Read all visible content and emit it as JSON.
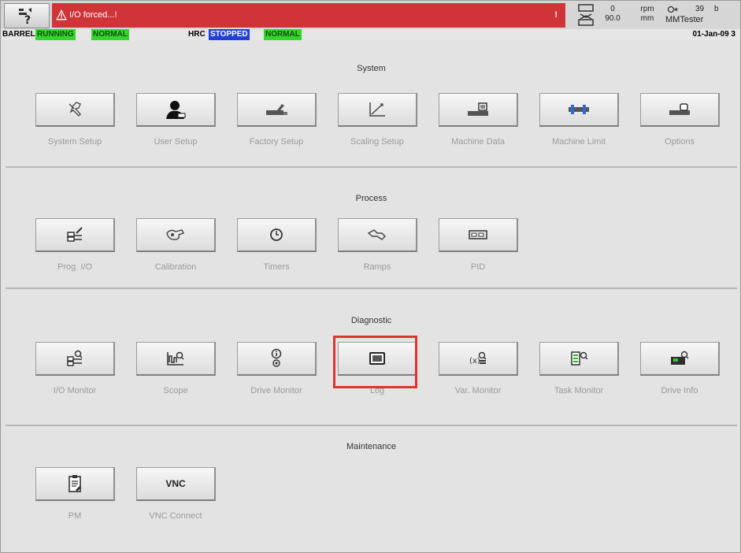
{
  "topbar": {
    "alarm_text": "I/O forced...!",
    "alarm_count": "!",
    "speed_value": "0",
    "speed_value2": "90.0",
    "speed_unit": "rpm",
    "pos_unit": "mm",
    "counter": "39",
    "counter_suffix": "b",
    "user": "MMTester",
    "alarm_color": "#d03438"
  },
  "status": {
    "barrel_label": "BARREL",
    "barrel_state": "RUNNING",
    "barrel_mode": "NORMAL",
    "hrc_label": "HRC",
    "hrc_state": "STOPPED",
    "hrc_mode": "NORMAL",
    "date": "01-Jan-09 3"
  },
  "sections": {
    "system": {
      "title": "System",
      "tiles": [
        {
          "label": "System Setup",
          "icon": "wrench-icon"
        },
        {
          "label": "User Setup",
          "icon": "user-icon"
        },
        {
          "label": "Factory Setup",
          "icon": "factory-icon"
        },
        {
          "label": "Scaling Setup",
          "icon": "scaling-chart-icon"
        },
        {
          "label": "Machine Data",
          "icon": "machine-data-icon"
        },
        {
          "label": "Machine Limit",
          "icon": "machine-limit-icon"
        },
        {
          "label": "Options",
          "icon": "options-icon"
        }
      ]
    },
    "process": {
      "title": "Process",
      "tiles": [
        {
          "label": "Prog. I/O",
          "icon": "prog-io-icon"
        },
        {
          "label": "Calibration",
          "icon": "calibration-icon"
        },
        {
          "label": "Timers",
          "icon": "timer-icon"
        },
        {
          "label": "Ramps",
          "icon": "ramps-icon"
        },
        {
          "label": "PID",
          "icon": "pid-icon"
        }
      ]
    },
    "diagnostic": {
      "title": "Diagnostic",
      "tiles": [
        {
          "label": "I/O Monitor",
          "icon": "io-monitor-icon"
        },
        {
          "label": "Scope",
          "icon": "scope-icon"
        },
        {
          "label": "Drive Monitor",
          "icon": "drive-monitor-icon"
        },
        {
          "label": "Log",
          "icon": "log-icon",
          "highlighted": true
        },
        {
          "label": "Var. Monitor",
          "icon": "var-monitor-icon"
        },
        {
          "label": "Task Monitor",
          "icon": "task-monitor-icon"
        },
        {
          "label": "Drive Info",
          "icon": "drive-info-icon"
        }
      ]
    },
    "maintenance": {
      "title": "Maintenance",
      "tiles": [
        {
          "label": "PM",
          "icon": "pm-clipboard-icon"
        },
        {
          "label": "VNC Connect",
          "icon": "vnc-icon",
          "icon_text": "VNC"
        }
      ]
    }
  },
  "highlight_color": "#e0332f"
}
